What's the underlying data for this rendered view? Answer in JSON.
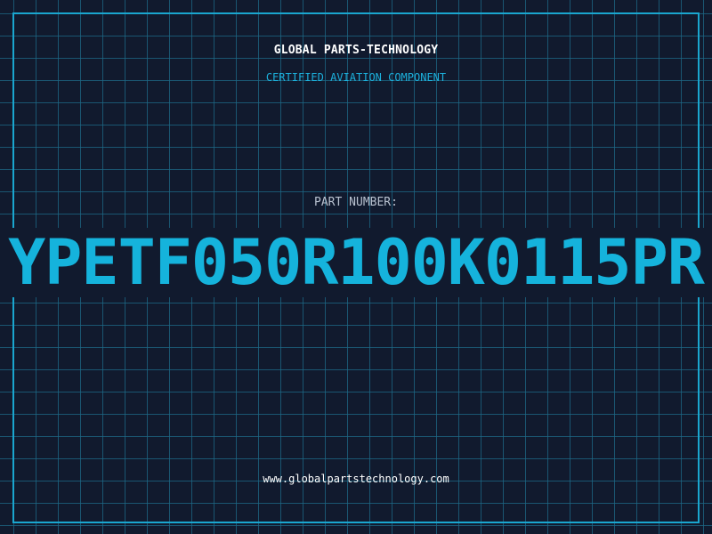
{
  "header": {
    "brand": "GLOBAL PARTS-TECHNOLOGY",
    "tagline": "CERTIFIED AVIATION COMPONENT"
  },
  "part": {
    "label": "PART NUMBER:",
    "number": "YPETF050R100K0115PR"
  },
  "footer": {
    "website": "www.globalpartstechnology.com"
  },
  "colors": {
    "background": "#111a2e",
    "grid": "#1e6987",
    "accent": "#1aa6cf",
    "text_primary": "#ffffff",
    "text_muted": "#b9c2d0"
  }
}
